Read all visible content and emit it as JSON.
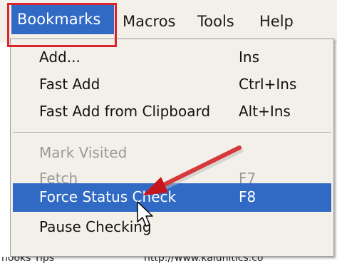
{
  "menubar": {
    "items": [
      {
        "label": "Bookmarks"
      },
      {
        "label": "Macros"
      },
      {
        "label": "Tools"
      },
      {
        "label": "Help"
      }
    ]
  },
  "dropdown": {
    "groups": [
      [
        {
          "label": "Add...",
          "shortcut": "Ins",
          "enabled": true
        },
        {
          "label": "Fast Add",
          "shortcut": "Ctrl+Ins",
          "enabled": true
        },
        {
          "label": "Fast Add from Clipboard",
          "shortcut": "Alt+Ins",
          "enabled": true
        }
      ],
      [
        {
          "label": "Mark Visited",
          "shortcut": "",
          "enabled": false
        },
        {
          "label": "Fetch",
          "shortcut": "F7",
          "enabled": false
        }
      ],
      [
        {
          "label": "Force Status Check",
          "shortcut": "F8",
          "enabled": true,
          "selected": true
        },
        {
          "label": "Pause Checking",
          "shortcut": "",
          "enabled": true
        }
      ]
    ]
  },
  "background": {
    "fragments": [
      "nooks Tips",
      "http://www.kalunitics.co"
    ]
  },
  "colors": {
    "highlight": "#316ac5",
    "annotation_red": "#d9252c",
    "menu_bg": "#f2f0e8",
    "disabled_text": "#9a9a9a"
  },
  "icons": {
    "cursor": "arrow-cursor-icon",
    "annotation": "red-arrow-icon"
  }
}
